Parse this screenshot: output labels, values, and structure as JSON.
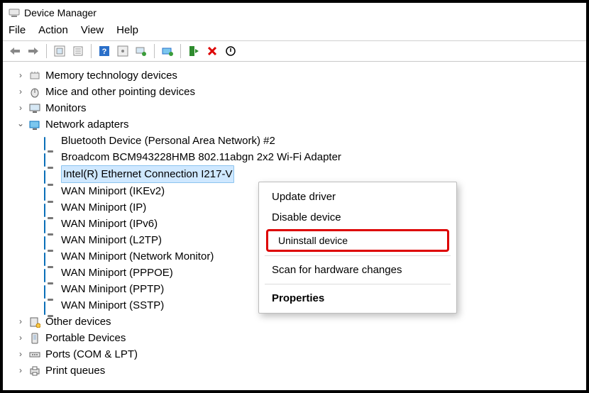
{
  "window": {
    "title": "Device Manager"
  },
  "menu": {
    "file": "File",
    "action": "Action",
    "view": "View",
    "help": "Help"
  },
  "tree": {
    "categories": [
      {
        "label": "Memory technology devices",
        "expanded": false
      },
      {
        "label": "Mice and other pointing devices",
        "expanded": false
      },
      {
        "label": "Monitors",
        "expanded": false
      },
      {
        "label": "Network adapters",
        "expanded": true
      },
      {
        "label": "Other devices",
        "expanded": false
      },
      {
        "label": "Portable Devices",
        "expanded": false
      },
      {
        "label": "Ports (COM & LPT)",
        "expanded": false
      },
      {
        "label": "Print queues",
        "expanded": false
      }
    ],
    "network_children": [
      "Bluetooth Device (Personal Area Network) #2",
      "Broadcom BCM943228HMB 802.11abgn 2x2 Wi-Fi Adapter",
      "Intel(R) Ethernet Connection I217-V",
      "WAN Miniport (IKEv2)",
      "WAN Miniport (IP)",
      "WAN Miniport (IPv6)",
      "WAN Miniport (L2TP)",
      "WAN Miniport (Network Monitor)",
      "WAN Miniport (PPPOE)",
      "WAN Miniport (PPTP)",
      "WAN Miniport (SSTP)"
    ],
    "selected_index": 2
  },
  "context_menu": {
    "update": "Update driver",
    "disable": "Disable device",
    "uninstall": "Uninstall device",
    "scan": "Scan for hardware changes",
    "properties": "Properties"
  }
}
